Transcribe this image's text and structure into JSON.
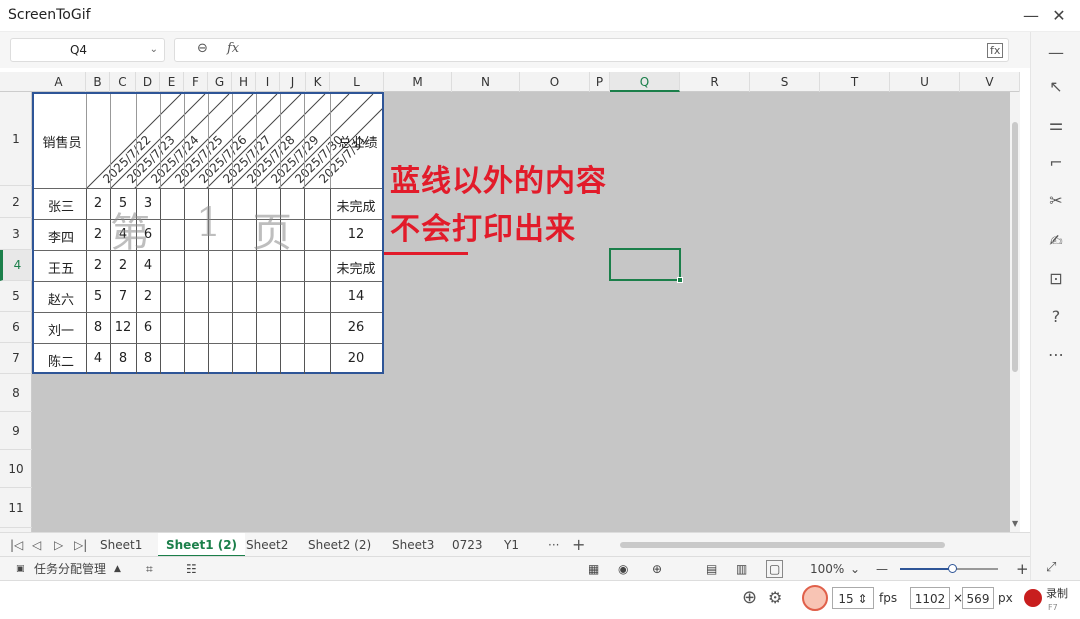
{
  "app": {
    "title": "ScreenToGif"
  },
  "formula_bar": {
    "name_box": "Q4",
    "fx": "fx"
  },
  "columns": [
    "A",
    "B",
    "C",
    "D",
    "E",
    "F",
    "G",
    "H",
    "I",
    "J",
    "K",
    "L",
    "M",
    "N",
    "O",
    "P",
    "Q",
    "R",
    "S",
    "T",
    "U",
    "V"
  ],
  "selected_column": "Q",
  "rows": [
    "1",
    "2",
    "3",
    "4",
    "5",
    "6",
    "7",
    "8",
    "9",
    "10",
    "11"
  ],
  "selected_row": "4",
  "table": {
    "header_salesperson": "销售员",
    "header_total": "总业绩",
    "dates": [
      "2025/7/22",
      "2025/7/23",
      "2025/7/24",
      "2025/7/25",
      "2025/7/26",
      "2025/7/27",
      "2025/7/28",
      "2025/7/29",
      "2025/7/30",
      "2025/7/31"
    ],
    "rows": [
      {
        "name": "张三",
        "b": "2",
        "c": "5",
        "d": "3",
        "total": "未完成"
      },
      {
        "name": "李四",
        "b": "2",
        "c": "4",
        "d": "6",
        "total": "12"
      },
      {
        "name": "王五",
        "b": "2",
        "c": "2",
        "d": "4",
        "total": "未完成"
      },
      {
        "name": "赵六",
        "b": "5",
        "c": "7",
        "d": "2",
        "total": "14"
      },
      {
        "name": "刘一",
        "b": "8",
        "c": "12",
        "d": "6",
        "total": "26"
      },
      {
        "name": "陈二",
        "b": "4",
        "c": "8",
        "d": "8",
        "total": "20"
      }
    ]
  },
  "watermark": {
    "chars": [
      "第",
      "1",
      "页"
    ]
  },
  "annotation": {
    "line1": "蓝线以外的内容",
    "line2": "不会打印出来",
    "color": "#e21b2a"
  },
  "sheet_tabs": [
    "Sheet1",
    "Sheet1 (2)",
    "Sheet2",
    "Sheet2 (2)",
    "Sheet3",
    "0723",
    "Y1"
  ],
  "active_tab": "Sheet1 (2)",
  "status": {
    "task_label": "任务分配管理",
    "zoom": "100%"
  },
  "recorder": {
    "fps_value": "15",
    "fps_label": "fps",
    "width": "1102",
    "times": "×",
    "height": "569",
    "px": "px",
    "record_label": "录制",
    "record_shortcut": "F7"
  },
  "colors": {
    "accent": "#1b7f4a",
    "print_border": "#2e5597"
  }
}
